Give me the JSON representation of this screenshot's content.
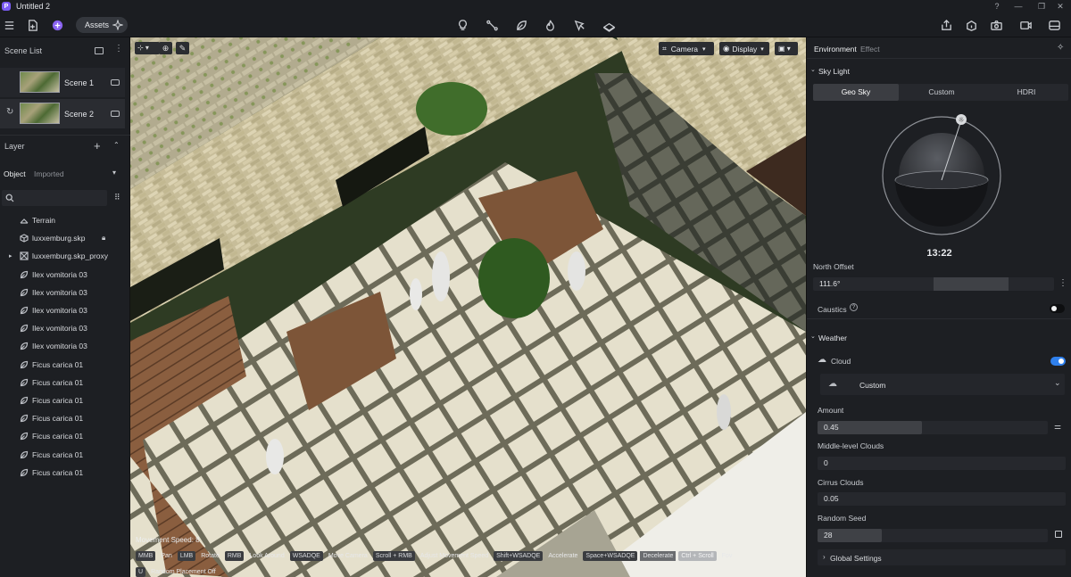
{
  "window": {
    "app_icon": "P",
    "title": "Untitled 2"
  },
  "toolbar": {
    "assets_label": "Assets",
    "center_tools": [
      "light-bulb-icon",
      "path-icon",
      "leaf-icon",
      "fire-icon",
      "pen-icon",
      "terrain-icon"
    ],
    "right_tools": [
      "share-icon",
      "export-icon",
      "screenshot-icon",
      "video-icon",
      "render-icon"
    ]
  },
  "left": {
    "scene_list_title": "Scene List",
    "scenes": [
      {
        "label": "Scene 1"
      },
      {
        "label": "Scene 2"
      }
    ],
    "layer_title": "Layer",
    "tabs": {
      "object": "Object",
      "imported": "Imported"
    },
    "search_placeholder": "",
    "items": [
      {
        "label": "Terrain",
        "icon": "terrain-icon",
        "locked": false
      },
      {
        "label": "luxxemburg.skp",
        "icon": "model-icon",
        "locked": true
      },
      {
        "label": "luxxemburg.skp_proxy",
        "icon": "proxy-icon",
        "locked": false
      },
      {
        "label": "Ilex vomitoria 03",
        "icon": "leaf-icon"
      },
      {
        "label": "Ilex vomitoria 03",
        "icon": "leaf-icon"
      },
      {
        "label": "Ilex vomitoria 03",
        "icon": "leaf-icon"
      },
      {
        "label": "Ilex vomitoria 03",
        "icon": "leaf-icon"
      },
      {
        "label": "Ilex vomitoria 03",
        "icon": "leaf-icon"
      },
      {
        "label": "Ficus carica 01",
        "icon": "leaf-icon"
      },
      {
        "label": "Ficus carica 01",
        "icon": "leaf-icon"
      },
      {
        "label": "Ficus carica 01",
        "icon": "leaf-icon"
      },
      {
        "label": "Ficus carica 01",
        "icon": "leaf-icon"
      },
      {
        "label": "Ficus carica 01",
        "icon": "leaf-icon"
      },
      {
        "label": "Ficus carica 01",
        "icon": "leaf-icon"
      },
      {
        "label": "Ficus carica 01",
        "icon": "leaf-icon"
      }
    ]
  },
  "viewport": {
    "camera_label": "Camera",
    "display_label": "Display",
    "movement_speed": "Movement Speed: 8",
    "hints_line1": [
      {
        "key": "MMB",
        "action": "Pan"
      },
      {
        "key": "LMB",
        "action": "Rotate"
      },
      {
        "key": "RMB",
        "action": "Look Around"
      },
      {
        "key": "WSADQE",
        "action": "Move Camera"
      },
      {
        "key": "Scroll + RMB",
        "action": "Adjust Movement Speed"
      },
      {
        "key": "Shift+WSADQE",
        "action": "Accelerate"
      },
      {
        "key": "Space+WSADQE",
        "action": "Decelerate"
      },
      {
        "key": "Ctrl + Scroll",
        "action": "Fov"
      }
    ],
    "hints_line2": [
      {
        "key": "U",
        "action": "Random Placement Off"
      }
    ]
  },
  "right": {
    "tabs": {
      "environment": "Environment",
      "effect": "Effect"
    },
    "sky_light_title": "Sky Light",
    "sky_tabs": [
      "Geo Sky",
      "Custom",
      "HDRI"
    ],
    "time": "13:22",
    "north_offset_label": "North Offset",
    "north_offset_value": "111.6°",
    "caustics_label": "Caustics",
    "caustics_on": false,
    "weather_title": "Weather",
    "cloud_label": "Cloud",
    "cloud_on": true,
    "cloud_preset": "Custom",
    "amount_label": "Amount",
    "amount_value": "0.45",
    "middle_clouds_label": "Middle-level Clouds",
    "middle_clouds_value": "0",
    "cirrus_label": "Cirrus Clouds",
    "cirrus_value": "0.05",
    "seed_label": "Random Seed",
    "seed_value": "28",
    "global_settings_label": "Global Settings",
    "accent_color": "#2f80ed"
  }
}
